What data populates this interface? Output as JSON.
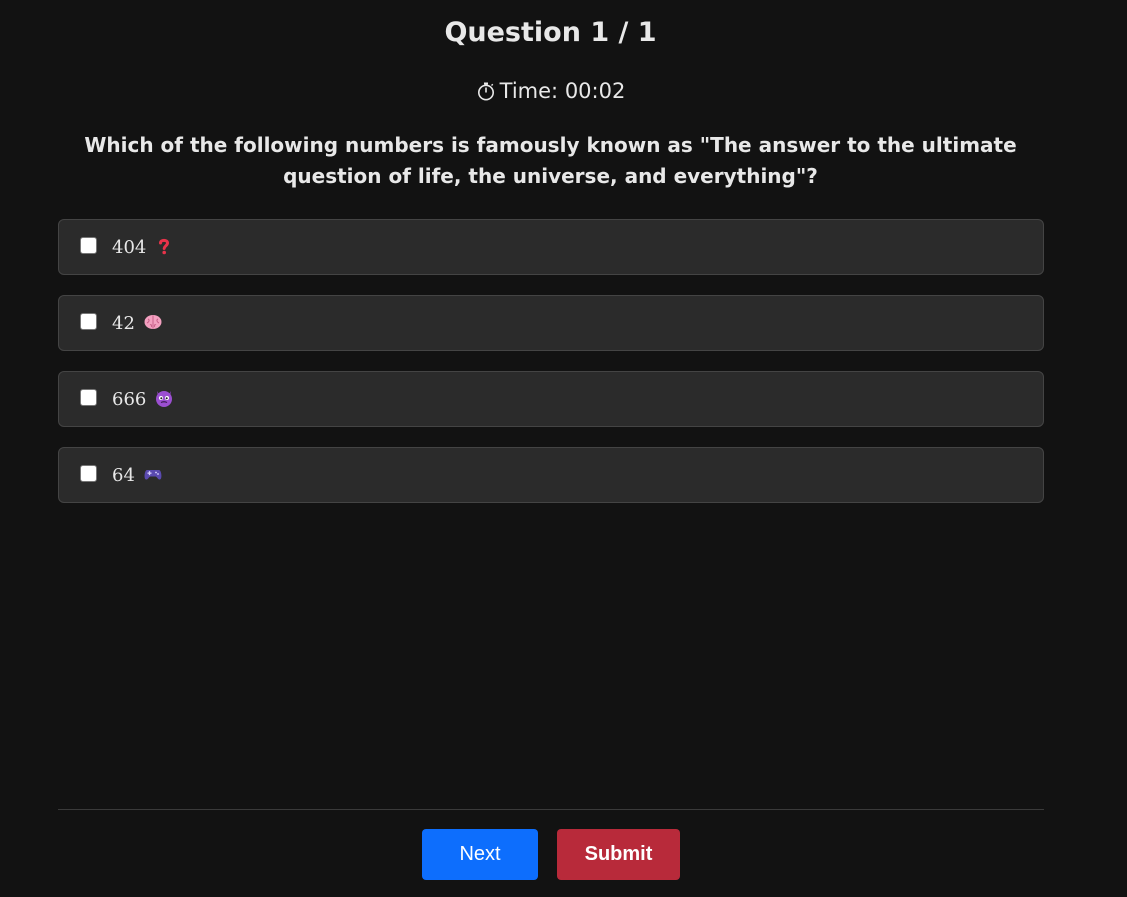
{
  "header": {
    "question_counter": "Question 1 / 1",
    "timer_label": "Time:",
    "timer_value": "00:02",
    "timer_icon": "stopwatch-icon"
  },
  "question": {
    "text": "Which of the following numbers is famously known as \"The answer to the ultimate question of life, the universe, and everything\"?"
  },
  "options": [
    {
      "label": "404",
      "icon": "question-mark-icon",
      "checked": false
    },
    {
      "label": "42",
      "icon": "brain-icon",
      "checked": false
    },
    {
      "label": "666",
      "icon": "devil-icon",
      "checked": false
    },
    {
      "label": "64",
      "icon": "game-controller-icon",
      "checked": false
    }
  ],
  "actions": {
    "next_label": "Next",
    "submit_label": "Submit"
  },
  "colors": {
    "background": "#121212",
    "option_bg": "#2b2b2b",
    "next_button": "#0d6efd",
    "submit_button": "#b82a3a"
  }
}
